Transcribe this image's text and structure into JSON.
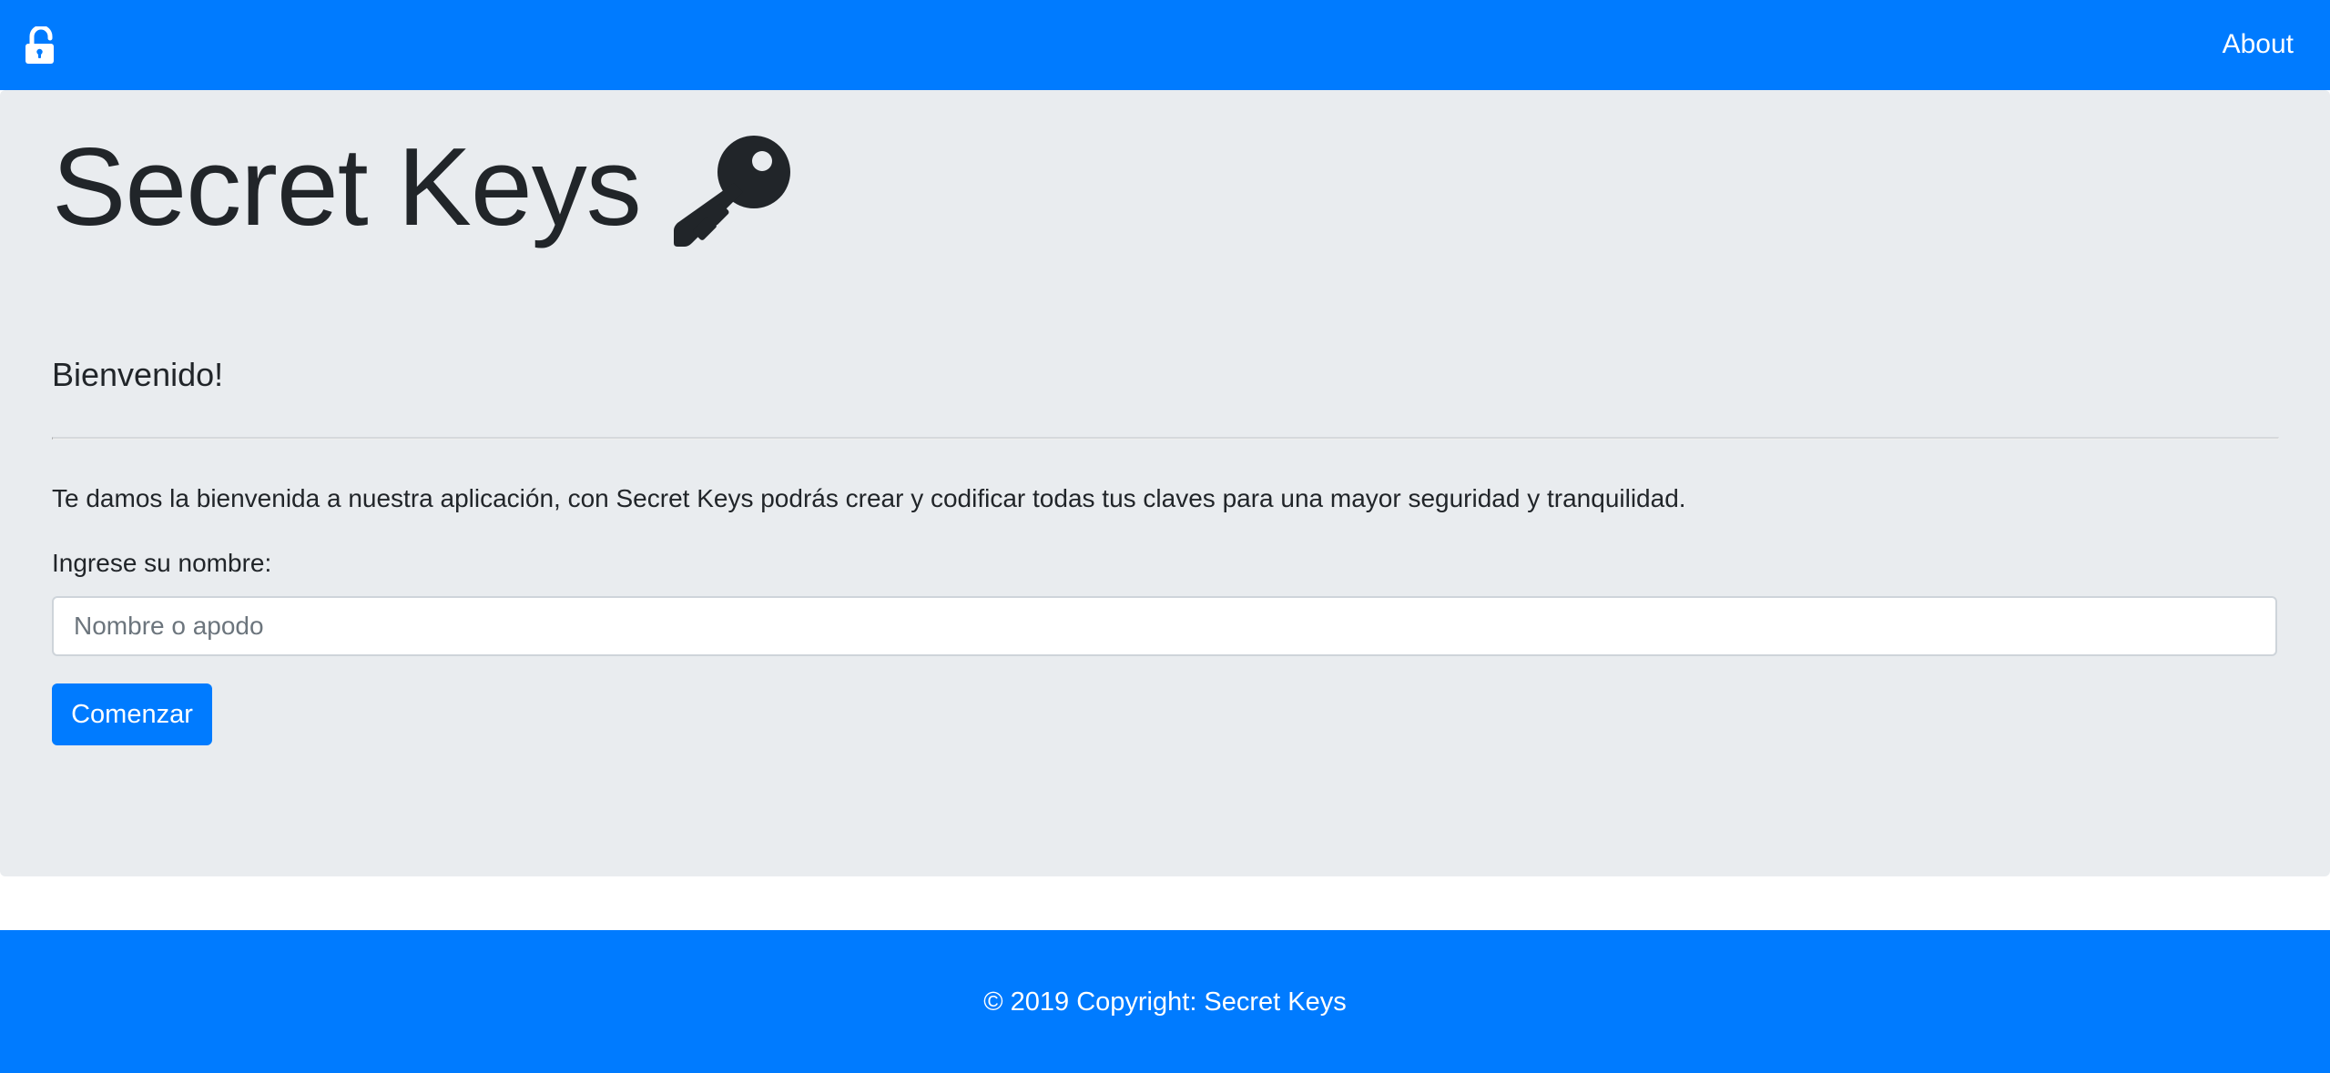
{
  "navbar": {
    "brand_icon": "unlock-icon",
    "about_label": "About",
    "background_color": "#007bff"
  },
  "jumbotron": {
    "title": "Secret Keys",
    "title_icon": "key-icon",
    "subtitle": "Bienvenido!",
    "intro_text": "Te damos la bienvenida a nuestra aplicación, con Secret Keys podrás crear y codificar todas tus claves para una mayor seguridad y tranquilidad.",
    "background_color": "#e9ecef"
  },
  "form": {
    "name_label": "Ingrese su nombre:",
    "name_value": "",
    "name_placeholder": "Nombre o apodo",
    "start_label": "Comenzar",
    "button_color": "#007bff"
  },
  "footer": {
    "copyright": "© 2019 Copyright: Secret Keys",
    "background_color": "#007bff"
  }
}
